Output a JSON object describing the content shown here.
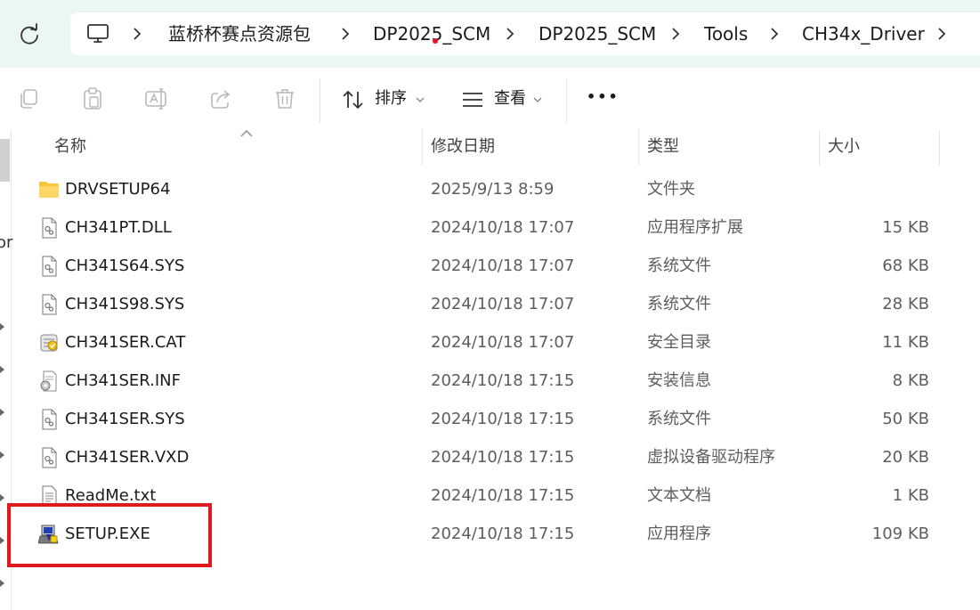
{
  "address": {
    "crumbs": [
      "蓝桥杯赛点资源包",
      "DP2025_SCM",
      "DP2025_SCM",
      "Tools",
      "CH34x_Driver"
    ],
    "icons": {
      "refresh": "refresh-icon",
      "pc": "computer-icon",
      "separator": "chevron-right-icon"
    }
  },
  "toolbar": {
    "sort_label": "排序",
    "view_label": "查看",
    "more_label": "•••",
    "icons": [
      "copy-icon",
      "paste-icon",
      "rename-icon",
      "share-icon",
      "delete-icon",
      "sort-icon",
      "view-icon"
    ]
  },
  "columns": {
    "name": "名称",
    "date": "修改日期",
    "type": "类型",
    "size": "大小"
  },
  "files": [
    {
      "name": "DRVSETUP64",
      "date": "2025/9/13 8:59",
      "type": "文件夹",
      "size": "",
      "icon": "folder-icon"
    },
    {
      "name": "CH341PT.DLL",
      "date": "2024/10/18 17:07",
      "type": "应用程序扩展",
      "size": "15 KB",
      "icon": "dll-file-icon"
    },
    {
      "name": "CH341S64.SYS",
      "date": "2024/10/18 17:07",
      "type": "系统文件",
      "size": "68 KB",
      "icon": "sys-file-icon"
    },
    {
      "name": "CH341S98.SYS",
      "date": "2024/10/18 17:07",
      "type": "系统文件",
      "size": "28 KB",
      "icon": "sys-file-icon"
    },
    {
      "name": "CH341SER.CAT",
      "date": "2024/10/18 17:07",
      "type": "安全目录",
      "size": "11 KB",
      "icon": "catalog-file-icon"
    },
    {
      "name": "CH341SER.INF",
      "date": "2024/10/18 17:15",
      "type": "安装信息",
      "size": "8 KB",
      "icon": "inf-file-icon"
    },
    {
      "name": "CH341SER.SYS",
      "date": "2024/10/18 17:15",
      "type": "系统文件",
      "size": "50 KB",
      "icon": "sys-file-icon"
    },
    {
      "name": "CH341SER.VXD",
      "date": "2024/10/18 17:15",
      "type": "虚拟设备驱动程序",
      "size": "20 KB",
      "icon": "vxd-file-icon"
    },
    {
      "name": "ReadMe.txt",
      "date": "2024/10/18 17:15",
      "type": "文本文档",
      "size": "1 KB",
      "icon": "text-file-icon"
    },
    {
      "name": "SETUP.EXE",
      "date": "2024/10/18 17:15",
      "type": "应用程序",
      "size": "109 KB",
      "icon": "setup-exe-icon"
    }
  ],
  "nav_partial_text": "or",
  "colors": {
    "highlight": "#e0191e",
    "addressbar_bg": "#eaf7f4",
    "folder": "#f8c43a"
  }
}
